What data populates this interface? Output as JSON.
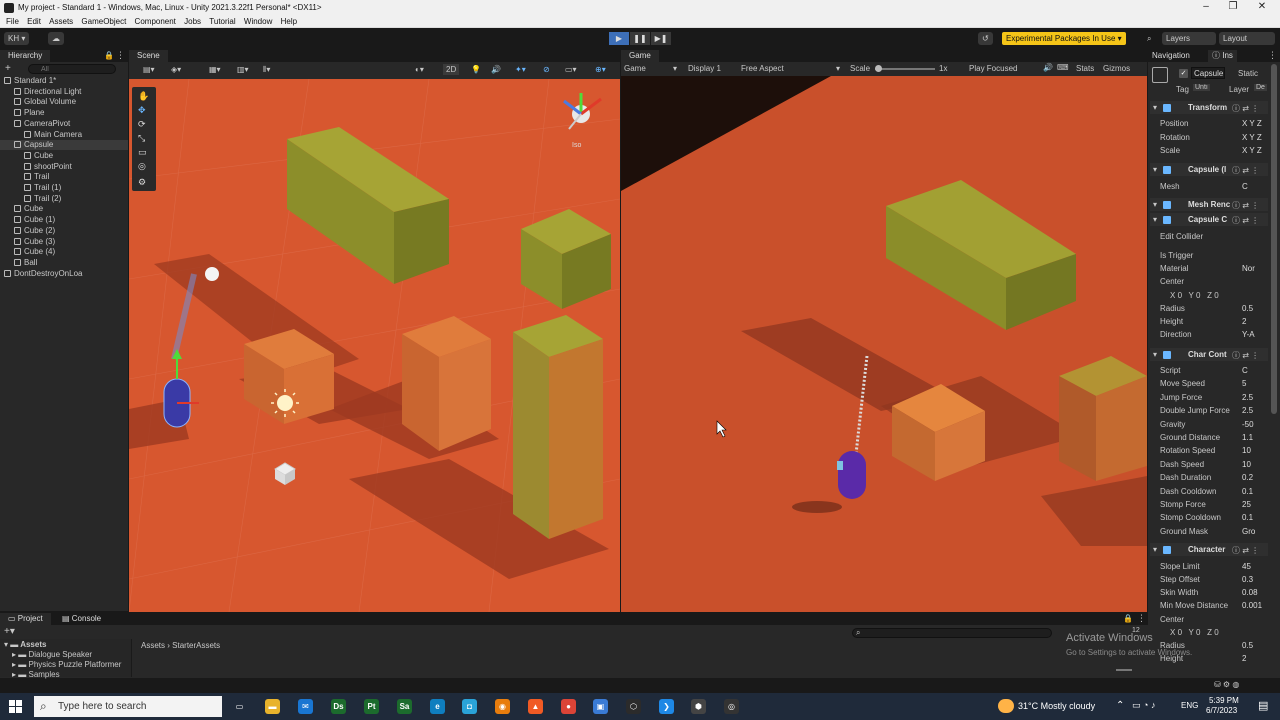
{
  "window": {
    "title": "My project - Standard 1 - Windows, Mac, Linux - Unity 2021.3.22f1 Personal* <DX11>",
    "controls": [
      "–",
      "❐",
      "✕"
    ]
  },
  "menu": [
    "File",
    "Edit",
    "Assets",
    "GameObject",
    "Component",
    "Jobs",
    "Tutorial",
    "Window",
    "Help"
  ],
  "toolbar": {
    "account": "KH ▾",
    "cloud": "☁",
    "play": "▶",
    "pause": "❚❚",
    "step": "▶❚",
    "experimental": "Experimental Packages In Use ▾",
    "layers": "Layers",
    "layout": "Layout"
  },
  "hierarchy": {
    "tab": "Hierarchy",
    "search_placeholder": "All",
    "items": [
      {
        "label": "Standard 1*",
        "depth": 0
      },
      {
        "label": "Directional Light",
        "depth": 1
      },
      {
        "label": "Global Volume",
        "depth": 1
      },
      {
        "label": "Plane",
        "depth": 1
      },
      {
        "label": "CameraPivot",
        "depth": 1
      },
      {
        "label": "Main Camera",
        "depth": 2
      },
      {
        "label": "Capsule",
        "depth": 1
      },
      {
        "label": "Cube",
        "depth": 2
      },
      {
        "label": "shootPoint",
        "depth": 2
      },
      {
        "label": "Trail",
        "depth": 2
      },
      {
        "label": "Trail (1)",
        "depth": 2
      },
      {
        "label": "Trail (2)",
        "depth": 2
      },
      {
        "label": "Cube",
        "depth": 1
      },
      {
        "label": "Cube (1)",
        "depth": 1
      },
      {
        "label": "Cube (2)",
        "depth": 1
      },
      {
        "label": "Cube (3)",
        "depth": 1
      },
      {
        "label": "Cube (4)",
        "depth": 1
      },
      {
        "label": "Ball",
        "depth": 1
      },
      {
        "label": "DontDestroyOnLoa",
        "depth": 0
      }
    ]
  },
  "scene": {
    "tab": "Scene",
    "toggle_2d": "2D",
    "iso": "Iso"
  },
  "game": {
    "tab": "Game",
    "mode": "Game",
    "display": "Display 1",
    "aspect": "Free Aspect",
    "scale_label": "Scale",
    "scale_value": "1x",
    "play_focused": "Play Focused",
    "stats": "Stats",
    "gizmos": "Gizmos"
  },
  "inspector": {
    "navigation_tab": "Navigation",
    "inspector_tab": "Ins",
    "object_name": "Capsule",
    "static": "Static",
    "tag_label": "Tag",
    "tag_value": "Untı",
    "layer_label": "Layer",
    "layer_value": "De",
    "components": {
      "transform": "Transform",
      "mesh_filter": "Capsule (I",
      "mesh_renderer": "Mesh Renc",
      "capsule_collider": "Capsule C",
      "char_controller_script": "Char Cont",
      "character_controller": "Character"
    },
    "transform": {
      "position": "Position",
      "rotation": "Rotation",
      "scale": "Scale",
      "xyz": "X Y Z"
    },
    "mesh": {
      "label": "Mesh",
      "value": "C"
    },
    "collider": [
      {
        "label": "Edit Collider",
        "value": ""
      },
      {
        "label": "Is Trigger",
        "value": ""
      },
      {
        "label": "Material",
        "value": "Nor"
      },
      {
        "label": "Center",
        "value": ""
      },
      {
        "label": "Radius",
        "value": "0.5"
      },
      {
        "label": "Height",
        "value": "2"
      },
      {
        "label": "Direction",
        "value": "Y-A"
      }
    ],
    "collider_center": {
      "x": "0",
      "y": "0",
      "z": "0"
    },
    "script_fields": [
      {
        "label": "Script",
        "value": "C"
      },
      {
        "label": "Move Speed",
        "value": "5"
      },
      {
        "label": "Jump Force",
        "value": "2.5"
      },
      {
        "label": "Double Jump Force",
        "value": "2.5"
      },
      {
        "label": "Gravity",
        "value": "-50"
      },
      {
        "label": "Ground Distance",
        "value": "1.1"
      },
      {
        "label": "Rotation Speed",
        "value": "10"
      },
      {
        "label": "Dash Speed",
        "value": "10"
      },
      {
        "label": "Dash Duration",
        "value": "0.2"
      },
      {
        "label": "Dash Cooldown",
        "value": "0.1"
      },
      {
        "label": "Stomp Force",
        "value": "25"
      },
      {
        "label": "Stomp Cooldown",
        "value": "0.1"
      },
      {
        "label": "Ground Mask",
        "value": "Gro"
      }
    ],
    "character_fields": [
      {
        "label": "Slope Limit",
        "value": "45"
      },
      {
        "label": "Step Offset",
        "value": "0.3"
      },
      {
        "label": "Skin Width",
        "value": "0.08"
      },
      {
        "label": "Min Move Distance",
        "value": "0.001"
      },
      {
        "label": "Center",
        "value": ""
      },
      {
        "label": "Radius",
        "value": "0.5"
      },
      {
        "label": "Height",
        "value": "2"
      }
    ],
    "character_center": {
      "x": "0",
      "y": "0",
      "z": "0"
    }
  },
  "project": {
    "tab_project": "Project",
    "tab_console": "Console",
    "root": "Assets",
    "folders": [
      "Dialogue Speaker",
      "Physics Puzzle Platformer",
      "Samples"
    ],
    "breadcrumb": [
      "Assets",
      "StarterAssets"
    ],
    "count": "12"
  },
  "watermark": {
    "line1": "Activate Windows",
    "line2": "Go to Settings to activate Windows."
  },
  "taskbar": {
    "search_placeholder": "Type here to search",
    "weather": "31°C  Mostly cloudy",
    "lang": "ENG",
    "time": "5:39 PM",
    "date": "6/7/2023",
    "apps": [
      {
        "name": "task-view-icon",
        "glyph": "▭",
        "color": "#1f2a3a"
      },
      {
        "name": "file-explorer-icon",
        "glyph": "▬",
        "color": "#e8b32c"
      },
      {
        "name": "mail-icon",
        "glyph": "✉",
        "color": "#1976d2"
      },
      {
        "name": "daz-studio-icon",
        "glyph": "Ds",
        "color": "#1c6b2d"
      },
      {
        "name": "painter-icon",
        "glyph": "Pt",
        "color": "#1c6b2d"
      },
      {
        "name": "substance-icon",
        "glyph": "Sa",
        "color": "#1c6b2d"
      },
      {
        "name": "edge-icon",
        "glyph": "e",
        "color": "#0f7ebf"
      },
      {
        "name": "store-icon",
        "glyph": "◘",
        "color": "#2aa3d8"
      },
      {
        "name": "blender-icon",
        "glyph": "◉",
        "color": "#e87d0d"
      },
      {
        "name": "brave-icon",
        "glyph": "▲",
        "color": "#f05a24"
      },
      {
        "name": "chrome-icon",
        "glyph": "●",
        "color": "#db4437"
      },
      {
        "name": "monitor-icon",
        "glyph": "▣",
        "color": "#3a7bd5"
      },
      {
        "name": "unity-hub-icon",
        "glyph": "⬡",
        "color": "#2b2b2b"
      },
      {
        "name": "vscode-icon",
        "glyph": "❯",
        "color": "#1e88e5"
      },
      {
        "name": "unity-icon",
        "glyph": "⬢",
        "color": "#444"
      },
      {
        "name": "obs-icon",
        "glyph": "◎",
        "color": "#333"
      }
    ]
  }
}
